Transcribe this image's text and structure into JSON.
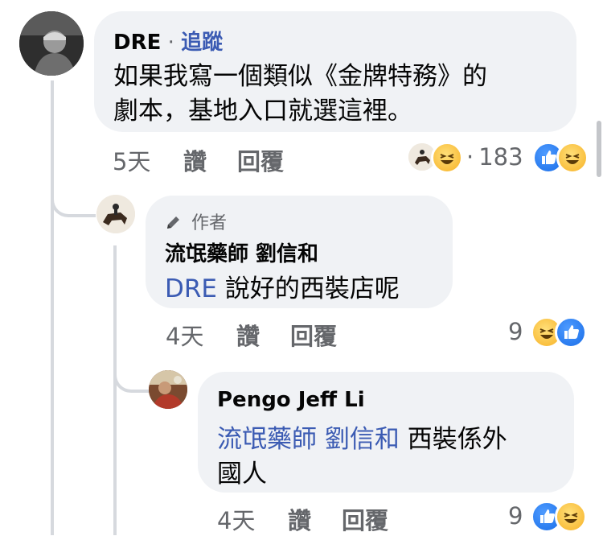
{
  "comment1": {
    "author": "DRE",
    "separator": " · ",
    "follow": "追蹤",
    "text_line1": "如果我寫一個類似《金牌特務》的",
    "text_line2": "劇本，基地入口就選這裡。",
    "time": "5天",
    "like": "讚",
    "reply": "回覆",
    "dot": "·",
    "reaction_count": "183"
  },
  "comment2": {
    "badge": "作者",
    "author": "流氓藥師 劉信和",
    "mention": "DRE",
    "text": " 說好的西裝店呢",
    "time": "4天",
    "like": "讚",
    "reply": "回覆",
    "reaction_count": "9"
  },
  "comment3": {
    "author": "Pengo Jeff Li",
    "mention": "流氓藥師 劉信和",
    "text_after_mention": " 西裝係外",
    "text_line2": "國人",
    "time": "4天",
    "like": "讚",
    "reply": "回覆",
    "reaction_count": "9"
  },
  "colors": {
    "link": "#3b5bb3",
    "bubble": "#f0f2f5",
    "meta": "#65676b",
    "like_reaction": "#1a6ee8",
    "haha_reaction": "#f7b125"
  },
  "icons": [
    "pencil-icon",
    "like-reaction-icon",
    "haha-reaction-icon",
    "profile-avatar"
  ]
}
